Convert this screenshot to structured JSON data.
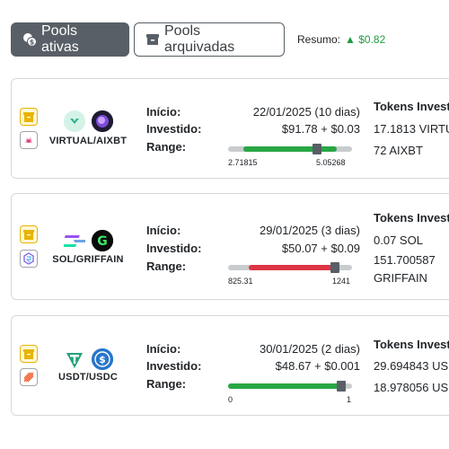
{
  "toolbar": {
    "active_tab": "Pools ativas",
    "archived_tab": "Pools arquivadas",
    "summary_label": "Resumo:",
    "summary_value": "▲ $0.82"
  },
  "labels": {
    "inicio": "Início:",
    "investido": "Investido:",
    "range": "Range:",
    "tokens_header": "Tokens Invest"
  },
  "colors": {
    "in_range": "#28a745",
    "out_of_range": "#dc3545",
    "archive_accent": "#e8b400",
    "dark_button": "#585f66"
  },
  "pools": [
    {
      "pair": "VIRTUAL/AIXBT",
      "inicio": "22/01/2025 (10 dias)",
      "investido": "$91.78 + $0.03",
      "range_min": "2.71815",
      "range_max": "5.05268",
      "range_fill_start": 0.12,
      "range_fill_end": 0.88,
      "current_position": 0.72,
      "in_range": true,
      "tokens": [
        "17.1813 VIRTU",
        "72 AIXBT"
      ]
    },
    {
      "pair": "SOL/GRIFFAIN",
      "inicio": "29/01/2025 (3 dias)",
      "investido": "$50.07 + $0.09",
      "range_min": "825.31",
      "range_max": "1241",
      "range_fill_start": 0.17,
      "range_fill_end": 0.84,
      "current_position": 0.86,
      "in_range": false,
      "tokens": [
        "0.07 SOL",
        "151.700587",
        "GRIFFAIN"
      ]
    },
    {
      "pair": "USDT/USDC",
      "inicio": "30/01/2025 (2 dias)",
      "investido": "$48.67 + $0.001",
      "range_min": "0",
      "range_max": "1",
      "range_fill_start": 0.0,
      "range_fill_end": 0.93,
      "current_position": 0.91,
      "in_range": true,
      "tokens": [
        "29.694843 US",
        "18.978056 US"
      ]
    }
  ]
}
